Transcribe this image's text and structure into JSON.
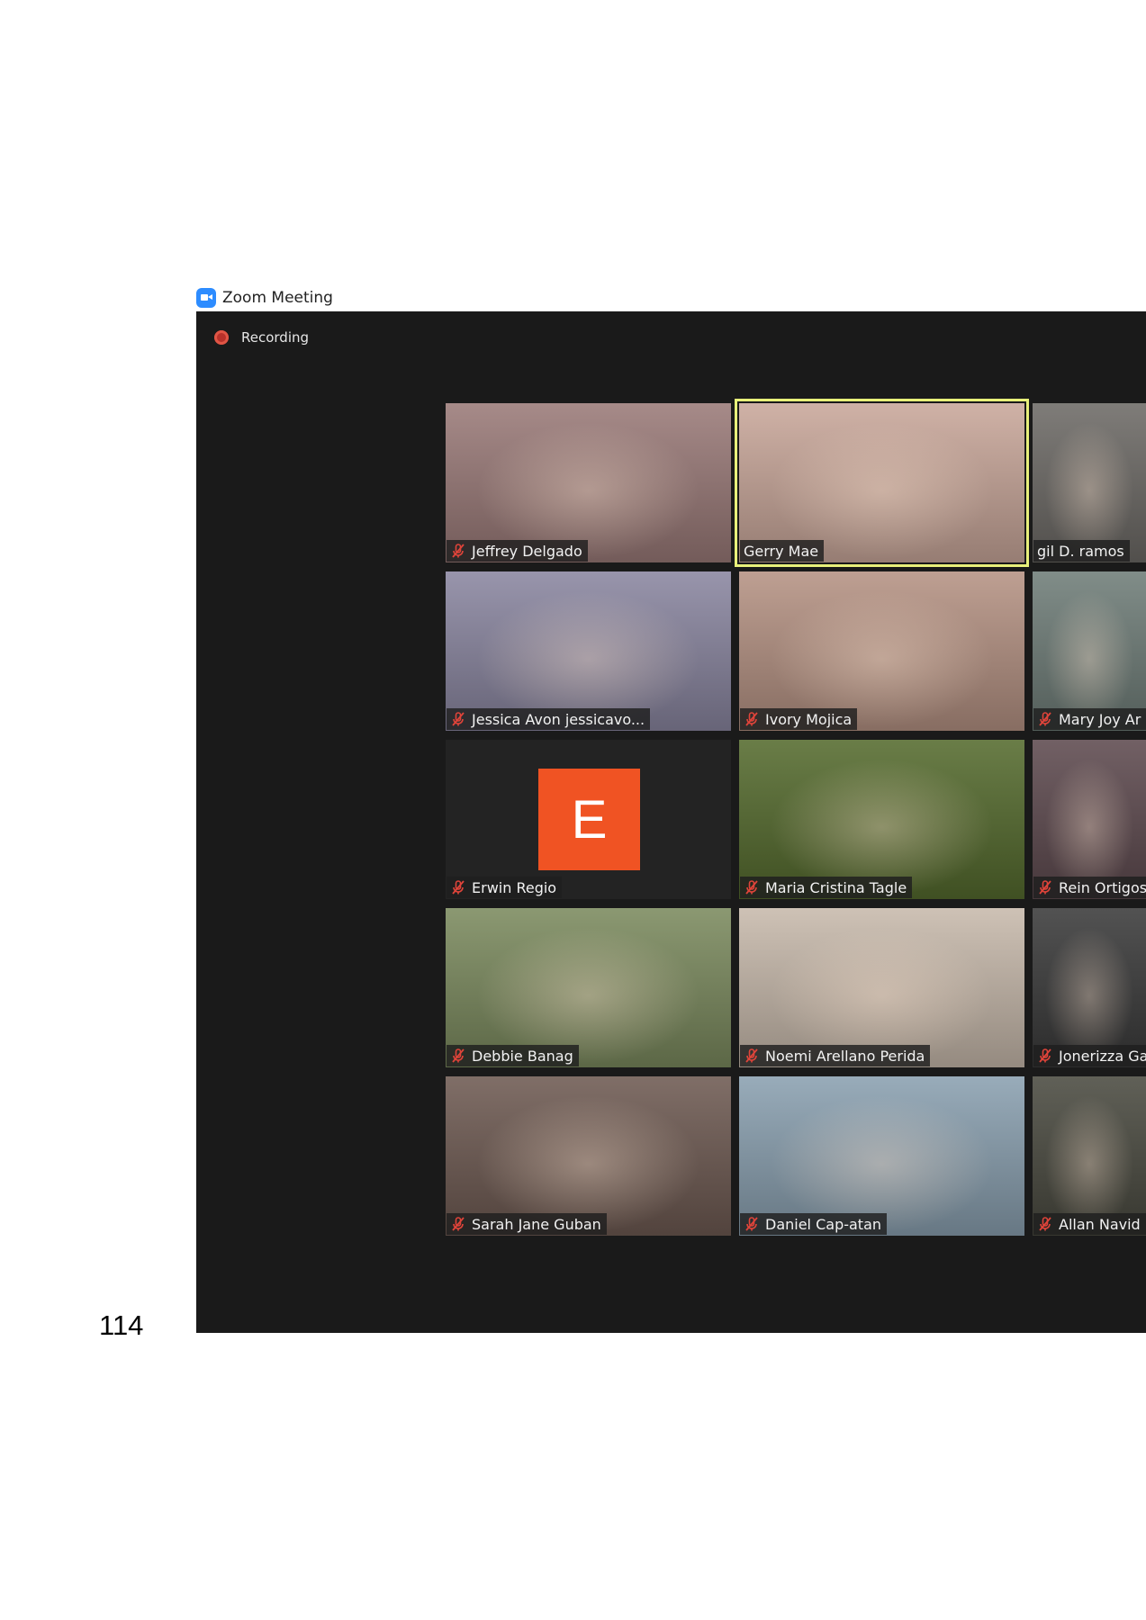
{
  "page": {
    "number": "114"
  },
  "window": {
    "title": "Zoom Meeting",
    "icon": "zoom-video-icon"
  },
  "meeting": {
    "recording_label": "Recording",
    "colors": {
      "background": "#1a1a1a",
      "active_speaker_border": "#e8f07a",
      "mute_icon": "#e0443a",
      "avatar_bg": "#f05323"
    },
    "participants": [
      {
        "name": "Jeffrey Delgado",
        "muted": true,
        "video": "on",
        "bg": "#9a7a78"
      },
      {
        "name": "Gerry Mae",
        "muted": false,
        "video": "on",
        "active": true,
        "bg": "#c9a79a"
      },
      {
        "name": "gil D. ramos",
        "muted": false,
        "video": "on",
        "bg": "#6d6a66"
      },
      {
        "name": "Jessica Avon jessicavo...",
        "muted": true,
        "video": "on",
        "bg": "#8a86a0"
      },
      {
        "name": "Ivory Mojica",
        "muted": true,
        "video": "on",
        "bg": "#b59283"
      },
      {
        "name": "Mary Joy Ar",
        "muted": true,
        "video": "on",
        "bg": "#6f7d78"
      },
      {
        "name": "Erwin Regio",
        "muted": true,
        "video": "off",
        "avatar_letter": "E",
        "bg": "#232323"
      },
      {
        "name": "Maria Cristina Tagle",
        "muted": true,
        "video": "on",
        "bg": "#556b2e"
      },
      {
        "name": "Rein Ortigos",
        "muted": true,
        "video": "on",
        "bg": "#5e4a4f"
      },
      {
        "name": "Debbie Banag",
        "muted": true,
        "video": "on",
        "bg": "#7b8a5e"
      },
      {
        "name": "Noemi Arellano Perida",
        "muted": true,
        "video": "on",
        "bg": "#c7b9ab"
      },
      {
        "name": "Jonerizza Ga",
        "muted": true,
        "video": "on",
        "bg": "#3a3a3a"
      },
      {
        "name": "Sarah Jane Guban",
        "muted": true,
        "video": "on",
        "bg": "#6e5a52"
      },
      {
        "name": "Daniel Cap-atan",
        "muted": true,
        "video": "on",
        "bg": "#8aa0b0"
      },
      {
        "name": "Allan Navid",
        "muted": true,
        "video": "on",
        "bg": "#4a4a40"
      }
    ]
  }
}
